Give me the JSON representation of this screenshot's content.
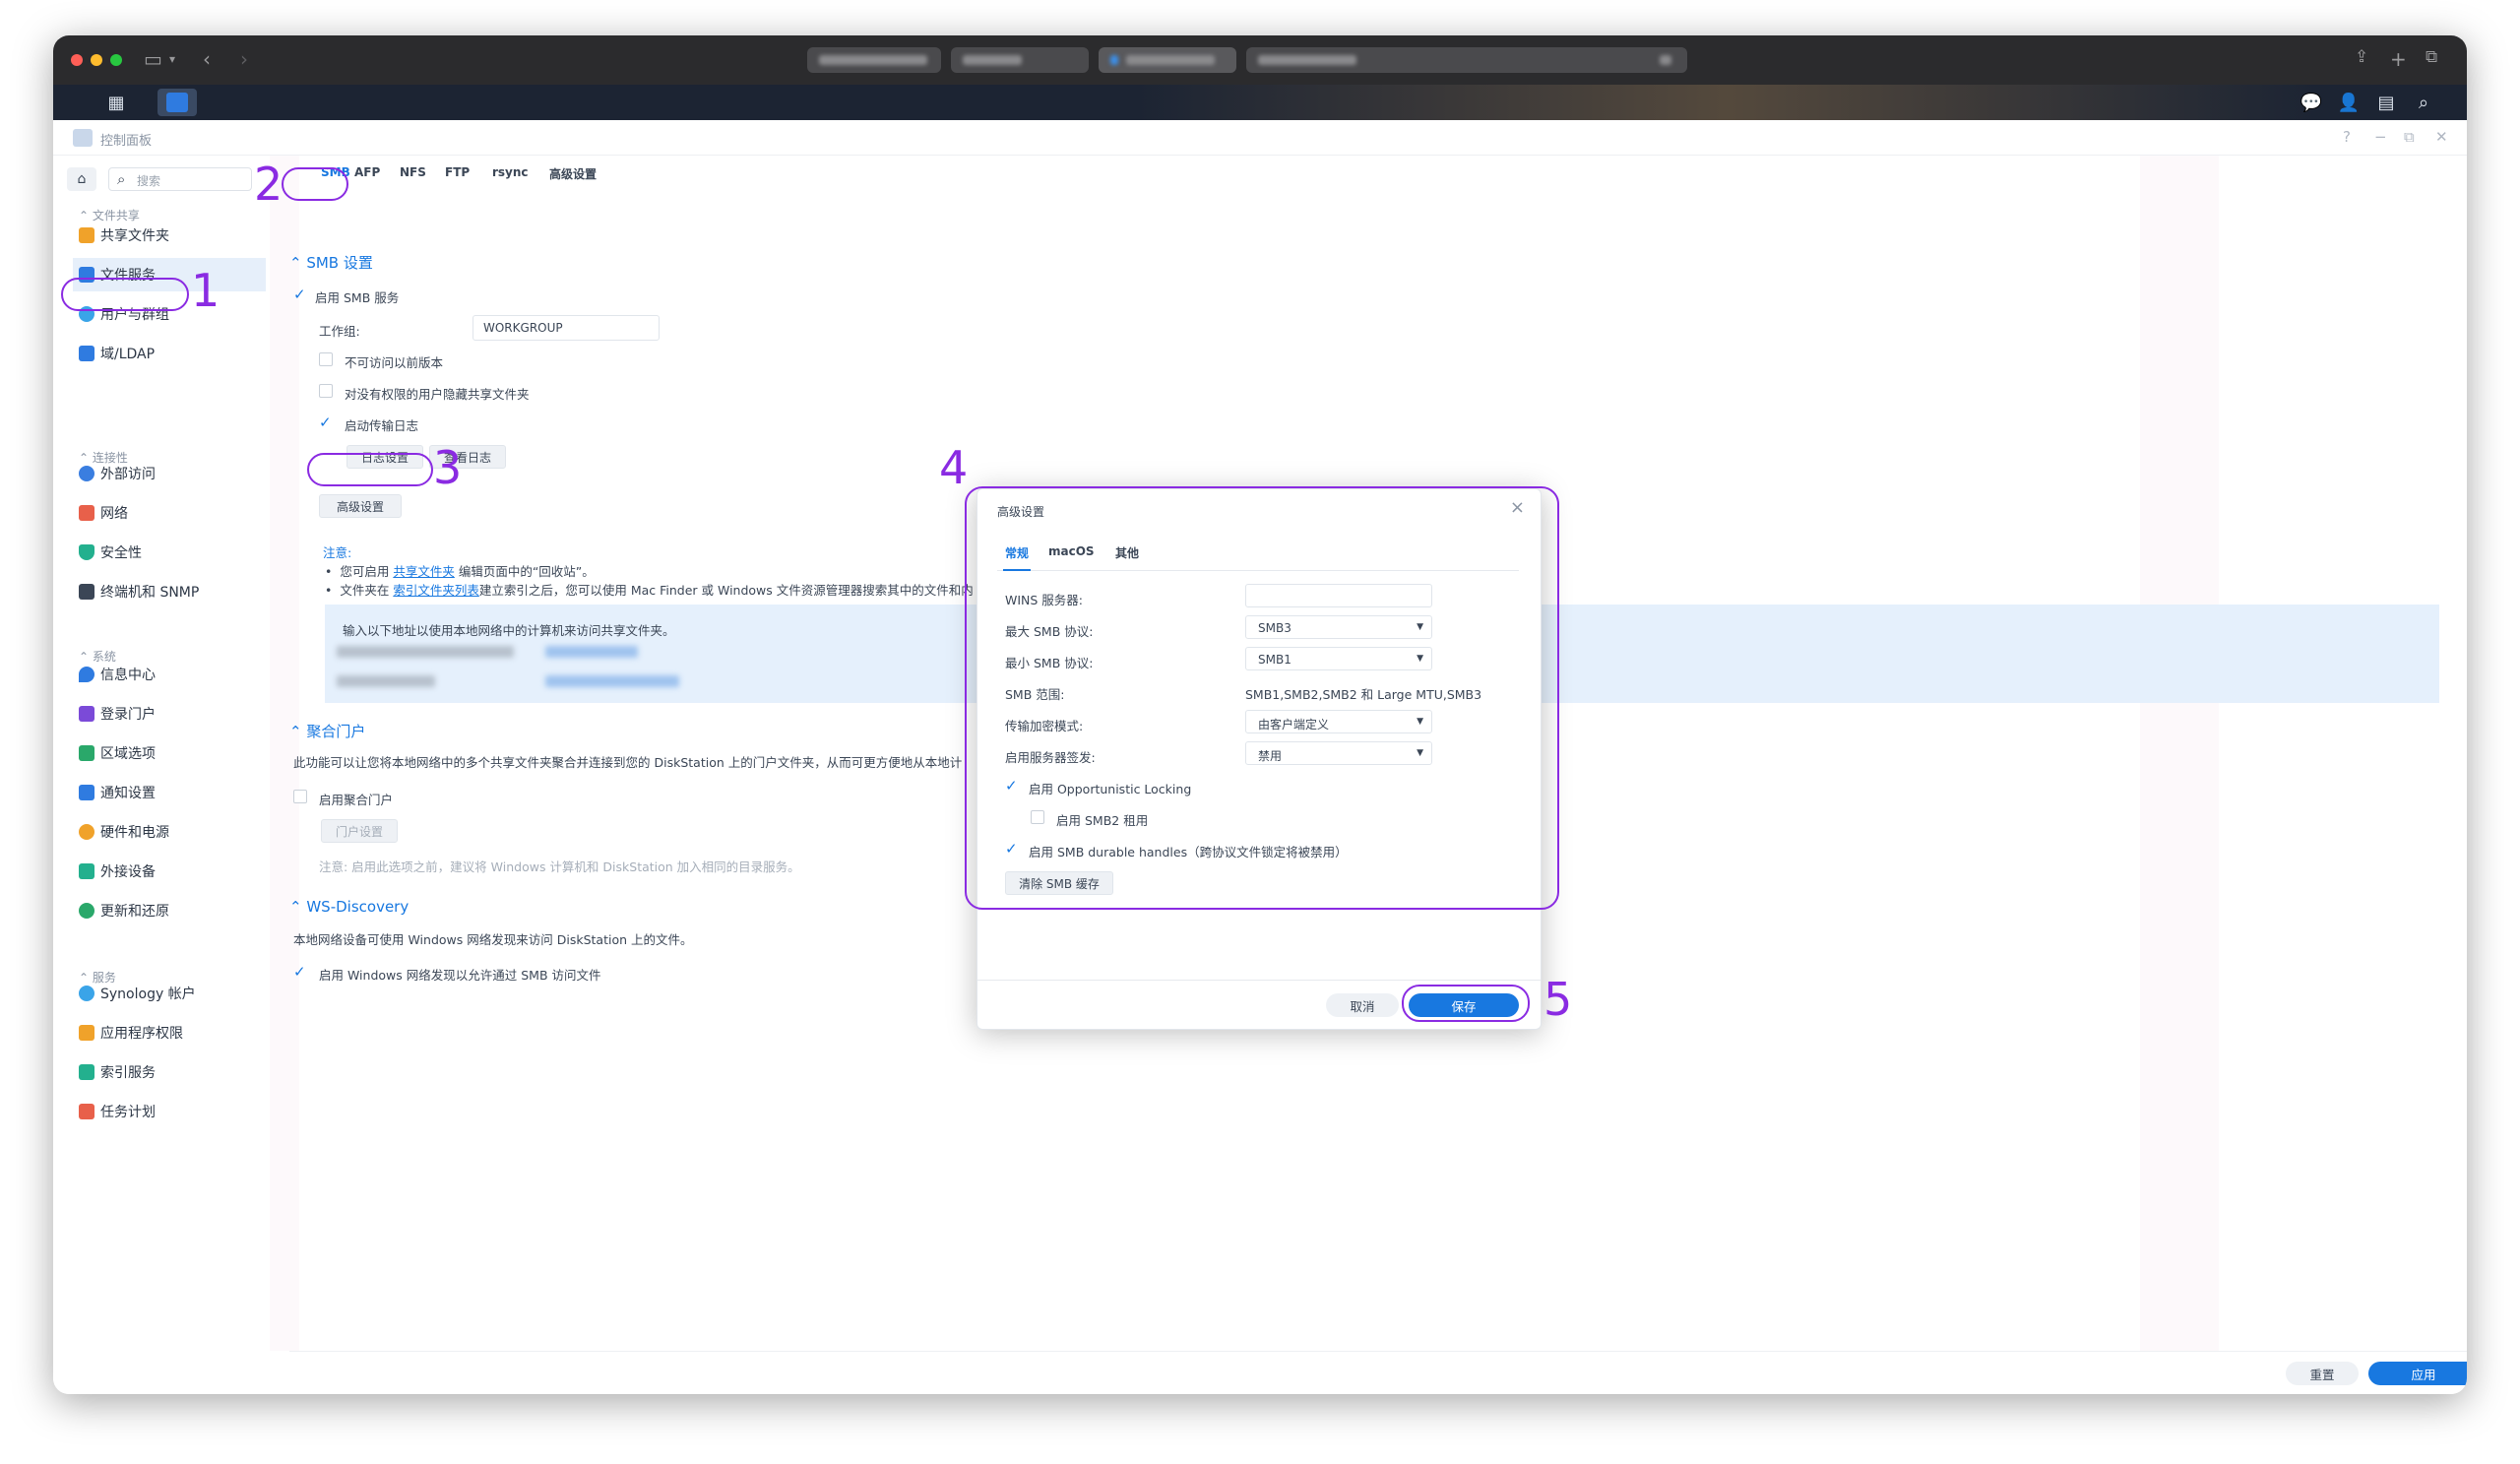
{
  "app": {
    "panel_title": "控制面板"
  },
  "sidebar": {
    "search_placeholder": "搜索",
    "groups": [
      {
        "title": "文件共享",
        "items": [
          "共享文件夹",
          "文件服务",
          "用户与群组",
          "域/LDAP"
        ]
      },
      {
        "title": "连接性",
        "items": [
          "外部访问",
          "网络",
          "安全性",
          "终端机和 SNMP"
        ]
      },
      {
        "title": "系统",
        "items": [
          "信息中心",
          "登录门户",
          "区域选项",
          "通知设置",
          "硬件和电源",
          "外接设备",
          "更新和还原"
        ]
      },
      {
        "title": "服务",
        "items": [
          "Synology 帐户",
          "应用程序权限",
          "索引服务",
          "任务计划"
        ]
      }
    ],
    "active_item": "文件服务"
  },
  "tabs": [
    "SMB",
    "AFP",
    "NFS",
    "FTP",
    "rsync",
    "高级设置"
  ],
  "active_tab": "SMB",
  "smb": {
    "section_title": "SMB 设置",
    "enable_label": "启用 SMB 服务",
    "workgroup_label": "工作组:",
    "workgroup_value": "WORKGROUP",
    "opt1": "不可访问以前版本",
    "opt2": "对没有权限的用户隐藏共享文件夹",
    "opt3": "启动传输日志",
    "log_settings_btn": "日志设置",
    "view_log_btn": "查看日志",
    "advanced_btn": "高级设置",
    "note_title": "注意:",
    "note1_a": "您可启用",
    "note1_link": "共享文件夹",
    "note1_b": "编辑页面中的“回收站”。",
    "note2_a": "文件夹在",
    "note2_link": "索引文件夹列表",
    "note2_b": "建立索引之后，您可以使用 Mac Finder 或 Windows 文件资源管理器搜索其中的文件和内",
    "info_text": "输入以下地址以使用本地网络中的计算机来访问共享文件夹。"
  },
  "portal": {
    "section_title": "聚合门户",
    "desc": "此功能可以让您将本地网络中的多个共享文件夹聚合并连接到您的 DiskStation 上的门户文件夹，从而可更方便地从本地计",
    "enable_label": "启用聚合门户",
    "portal_btn": "门户设置",
    "note": "注意:  启用此选项之前，建议将 Windows 计算机和 DiskStation 加入相同的目录服务。"
  },
  "ws": {
    "section_title": "WS-Discovery",
    "desc": "本地网络设备可使用 Windows 网络发现来访问 DiskStation 上的文件。",
    "enable_label": "启用 Windows 网络发现以允许通过 SMB 访问文件"
  },
  "footer": {
    "reset": "重置",
    "apply": "应用"
  },
  "dialog": {
    "title": "高级设置",
    "tabs": [
      "常规",
      "macOS",
      "其他"
    ],
    "wins_label": "WINS 服务器:",
    "max_smb_label": "最大 SMB 协议:",
    "max_smb_value": "SMB3",
    "min_smb_label": "最小 SMB 协议:",
    "min_smb_value": "SMB1",
    "range_label": "SMB 范围:",
    "range_value": "SMB1,SMB2,SMB2 和 Large MTU,SMB3",
    "encrypt_label": "传输加密模式:",
    "encrypt_value": "由客户端定义",
    "sign_label": "启用服务器签发:",
    "sign_value": "禁用",
    "oplock_label": "启用 Opportunistic Locking",
    "smb2_lease_label": "启用 SMB2 租用",
    "durable_label": "启用 SMB durable handles（跨协议文件锁定将被禁用）",
    "clear_cache_btn": "清除 SMB 缓存",
    "cancel": "取消",
    "save": "保存"
  },
  "annotations": [
    "1",
    "2",
    "3",
    "4",
    "5"
  ],
  "colors": {
    "accent": "#1878e0",
    "annotation": "#8a2be2",
    "taskbar": "#1c2433"
  }
}
